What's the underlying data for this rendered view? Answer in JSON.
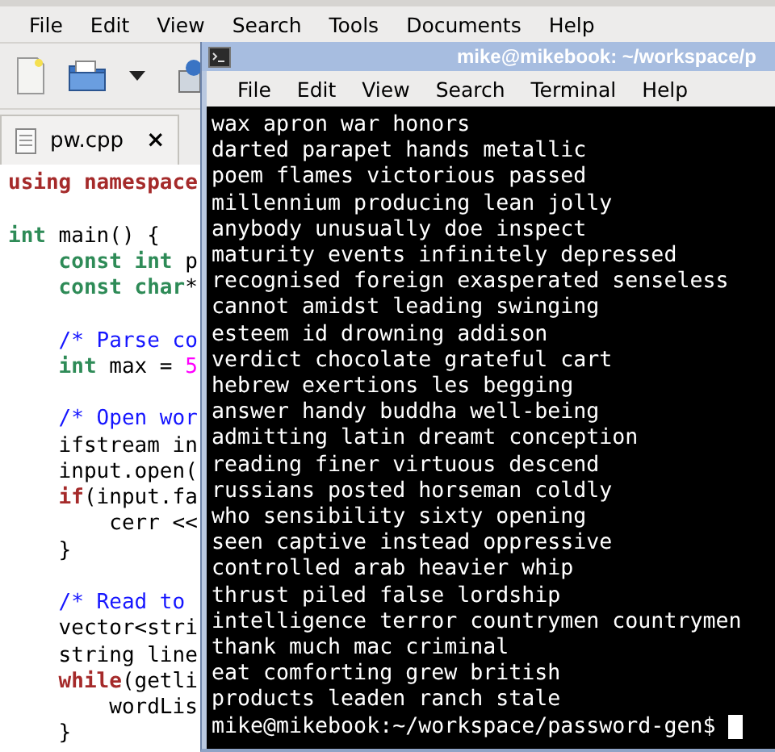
{
  "editor": {
    "menu": [
      "File",
      "Edit",
      "View",
      "Search",
      "Tools",
      "Documents",
      "Help"
    ],
    "tabs": [
      {
        "label": "pw.cpp",
        "selected": true,
        "close": "×"
      }
    ],
    "code_blocks": [
      {
        "lines": [
          [
            {
              "kind": "keyword",
              "text": "using namespace"
            }
          ]
        ]
      },
      {
        "lines": [
          [
            {
              "kind": "type",
              "text": "int"
            },
            {
              "kind": "plain",
              "text": " main() {"
            }
          ],
          [
            {
              "kind": "type",
              "text": "    const int"
            },
            {
              "kind": "plain",
              "text": " p"
            }
          ],
          [
            {
              "kind": "type",
              "text": "    const char"
            },
            {
              "kind": "plain",
              "text": "*"
            }
          ]
        ]
      },
      {
        "lines": [
          [
            {
              "kind": "comment",
              "text": "    /* Parse co"
            }
          ],
          [
            {
              "kind": "type",
              "text": "    int"
            },
            {
              "kind": "plain",
              "text": " max = "
            },
            {
              "kind": "number",
              "text": "5"
            }
          ]
        ]
      },
      {
        "lines": [
          [
            {
              "kind": "comment",
              "text": "    /* Open wor"
            }
          ],
          [
            {
              "kind": "plain",
              "text": "    ifstream in"
            }
          ],
          [
            {
              "kind": "plain",
              "text": "    input.open("
            }
          ],
          [
            {
              "kind": "keyword",
              "text": "    if"
            },
            {
              "kind": "plain",
              "text": "(input.fa"
            }
          ],
          [
            {
              "kind": "plain",
              "text": "        cerr <<"
            }
          ],
          [
            {
              "kind": "plain",
              "text": "    }"
            }
          ]
        ]
      },
      {
        "lines": [
          [
            {
              "kind": "comment",
              "text": "    /* Read to"
            }
          ],
          [
            {
              "kind": "plain",
              "text": "    vector<stri"
            }
          ],
          [
            {
              "kind": "plain",
              "text": "    string line"
            }
          ],
          [
            {
              "kind": "keyword",
              "text": "    while"
            },
            {
              "kind": "plain",
              "text": "(getli"
            }
          ],
          [
            {
              "kind": "plain",
              "text": "        wordLis"
            }
          ],
          [
            {
              "kind": "plain",
              "text": "    }"
            }
          ]
        ]
      }
    ]
  },
  "terminal": {
    "title": "mike@mikebook: ~/workspace/p",
    "menu": [
      "File",
      "Edit",
      "View",
      "Search",
      "Terminal",
      "Help"
    ],
    "output": [
      "wax apron war honors",
      "darted parapet hands metallic",
      "poem flames victorious passed",
      "millennium producing lean jolly",
      "anybody unusually doe inspect",
      "maturity events infinitely depressed",
      "recognised foreign exasperated senseless",
      "cannot amidst leading swinging",
      "esteem id drowning addison",
      "verdict chocolate grateful cart",
      "hebrew exertions les begging",
      "answer handy buddha well-being",
      "admitting latin dreamt conception",
      "reading finer virtuous descend",
      "russians posted horseman coldly",
      "who sensibility sixty opening",
      "seen captive instead oppressive",
      "controlled arab heavier whip",
      "thrust piled false lordship",
      "intelligence terror countrymen countrymen",
      "thank much mac criminal",
      "eat comforting grew british",
      "products leaden ranch stale"
    ],
    "prompt": "mike@mikebook:~/workspace/password-gen$"
  }
}
